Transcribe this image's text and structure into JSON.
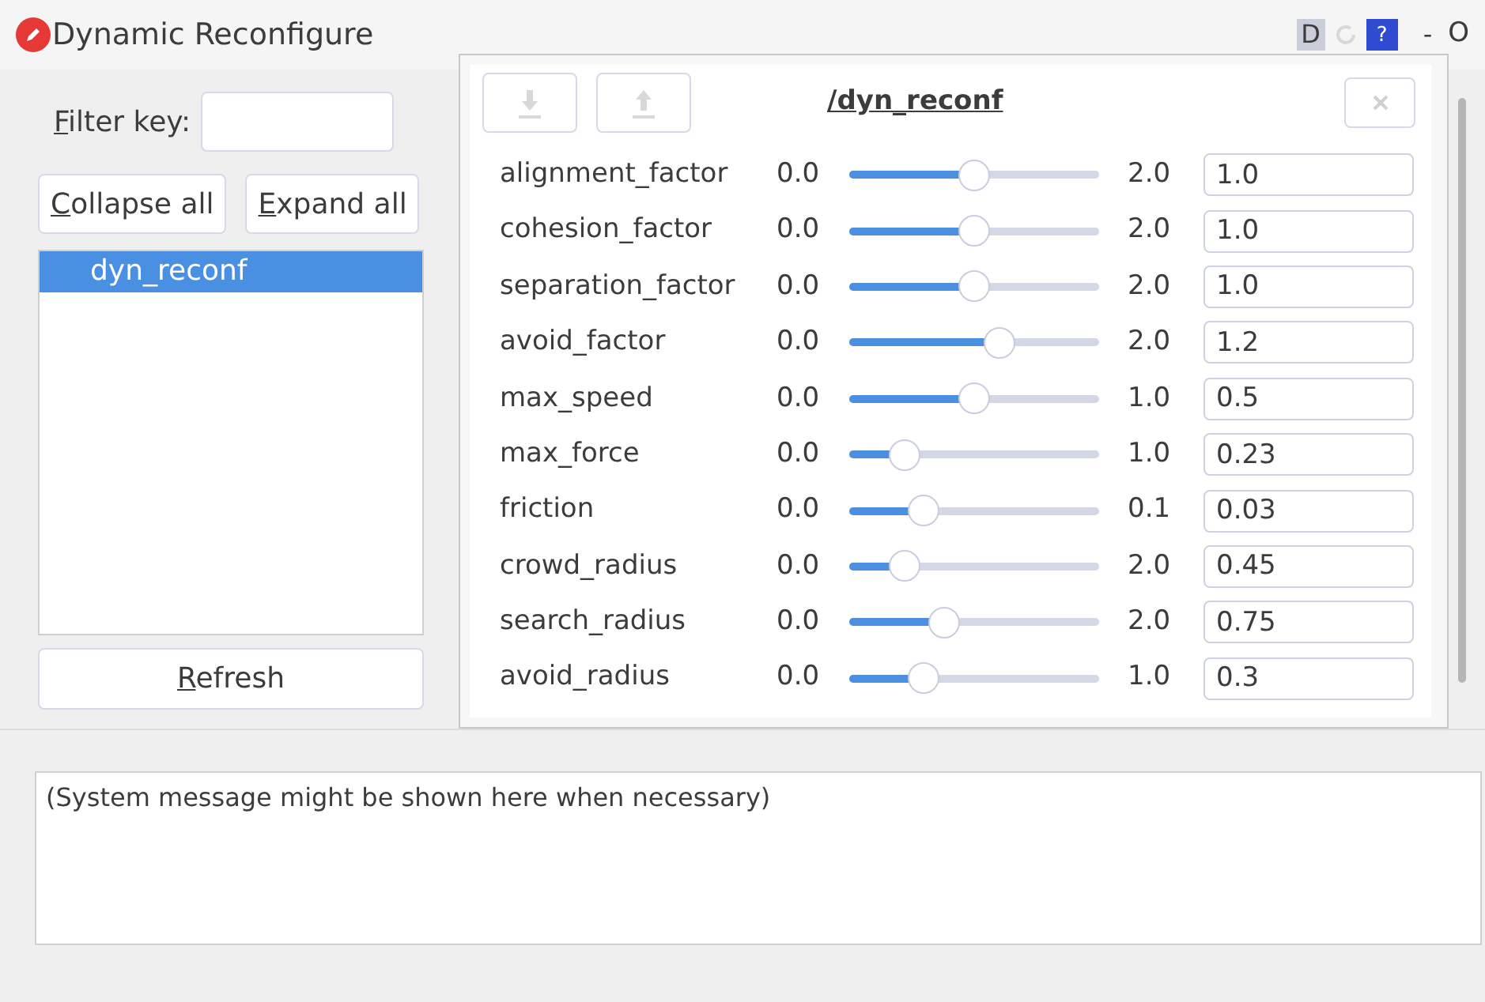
{
  "window": {
    "title": "Dynamic Reconfigure",
    "title_buttons": [
      "D",
      "?",
      "-",
      "O"
    ]
  },
  "filter": {
    "label": "Filter key:"
  },
  "tree_buttons": [
    "Collapse all",
    "Expand all"
  ],
  "tree": [
    {
      "label": "dyn_reconf",
      "selected": true
    }
  ],
  "refresh_button": "Refresh",
  "node_panel": {
    "title": "/dyn_reconf",
    "params": [
      {
        "name": "alignment_factor",
        "min": "0.0",
        "max": "2.0",
        "level": 0.5,
        "value": "1.0"
      },
      {
        "name": "cohesion_factor",
        "min": "0.0",
        "max": "2.0",
        "level": 0.5,
        "value": "1.0"
      },
      {
        "name": "separation_factor",
        "min": "0.0",
        "max": "2.0",
        "level": 0.5,
        "value": "1.0"
      },
      {
        "name": "avoid_factor",
        "min": "0.0",
        "max": "2.0",
        "level": 0.6,
        "value": "1.2"
      },
      {
        "name": "max_speed",
        "min": "0.0",
        "max": "1.0",
        "level": 0.5,
        "value": "0.5"
      },
      {
        "name": "max_force",
        "min": "0.0",
        "max": "1.0",
        "level": 0.22,
        "value": "0.23"
      },
      {
        "name": "friction",
        "min": "0.0",
        "max": "0.1",
        "level": 0.3,
        "value": "0.03"
      },
      {
        "name": "crowd_radius",
        "min": "0.0",
        "max": "2.0",
        "level": 0.22,
        "value": "0.45"
      },
      {
        "name": "search_radius",
        "min": "0.0",
        "max": "2.0",
        "level": 0.38,
        "value": "0.75"
      },
      {
        "name": "avoid_radius",
        "min": "0.0",
        "max": "1.0",
        "level": 0.3,
        "value": "0.3"
      }
    ]
  },
  "message": "(System message might be shown here when necessary)"
}
